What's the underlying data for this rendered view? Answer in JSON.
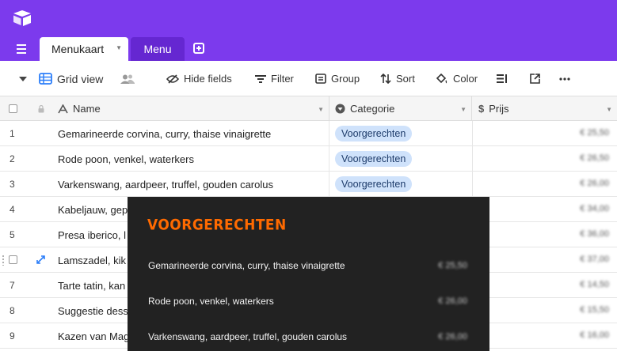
{
  "tabs": [
    {
      "label": "Menukaart",
      "active": true
    },
    {
      "label": "Menu",
      "active": false
    }
  ],
  "toolbar": {
    "view_label": "Grid view",
    "hide_fields": "Hide fields",
    "filter": "Filter",
    "group": "Group",
    "sort": "Sort",
    "color": "Color"
  },
  "columns": {
    "name": "Name",
    "category": "Categorie",
    "price": "Prijs"
  },
  "rows": [
    {
      "num": "1",
      "name": "Gemarineerde corvina, curry, thaise vinaigrette",
      "category": "Voorgerechten",
      "price": "€ 25,50"
    },
    {
      "num": "2",
      "name": "Rode poon, venkel, waterkers",
      "category": "Voorgerechten",
      "price": "€ 26,50"
    },
    {
      "num": "3",
      "name": "Varkenswang, aardpeer, truffel, gouden carolus",
      "category": "Voorgerechten",
      "price": "€ 26,00"
    },
    {
      "num": "4",
      "name": "Kabeljauw, gep",
      "category": "",
      "price": "€ 34,00"
    },
    {
      "num": "5",
      "name": "Presa iberico, l",
      "category": "",
      "price": "€ 36,00"
    },
    {
      "num": "",
      "name": "Lamszadel, kik",
      "category": "",
      "price": "€ 37,00"
    },
    {
      "num": "7",
      "name": "Tarte tatin, kan",
      "category": "",
      "price": "€ 14,50"
    },
    {
      "num": "8",
      "name": "Suggestie dess",
      "category": "",
      "price": "€ 15,50"
    },
    {
      "num": "9",
      "name": "Kazen van Mag",
      "category": "",
      "price": "€ 16,00"
    }
  ],
  "preview": {
    "title": "VOORGERECHTEN",
    "items": [
      {
        "name": "Gemarineerde corvina, curry, thaise vinaigrette",
        "price": "€ 25,50"
      },
      {
        "name": "Rode poon, venkel, waterkers",
        "price": "€ 26,00"
      },
      {
        "name": "Varkenswang, aardpeer, truffel, gouden carolus",
        "price": "€ 26,00"
      }
    ]
  },
  "colors": {
    "brand": "#7c3aed",
    "pill_bg": "#cfe2fb",
    "preview_bg": "#222222",
    "preview_title": "#ff6a00",
    "grid_icon": "#2d7ff9"
  }
}
